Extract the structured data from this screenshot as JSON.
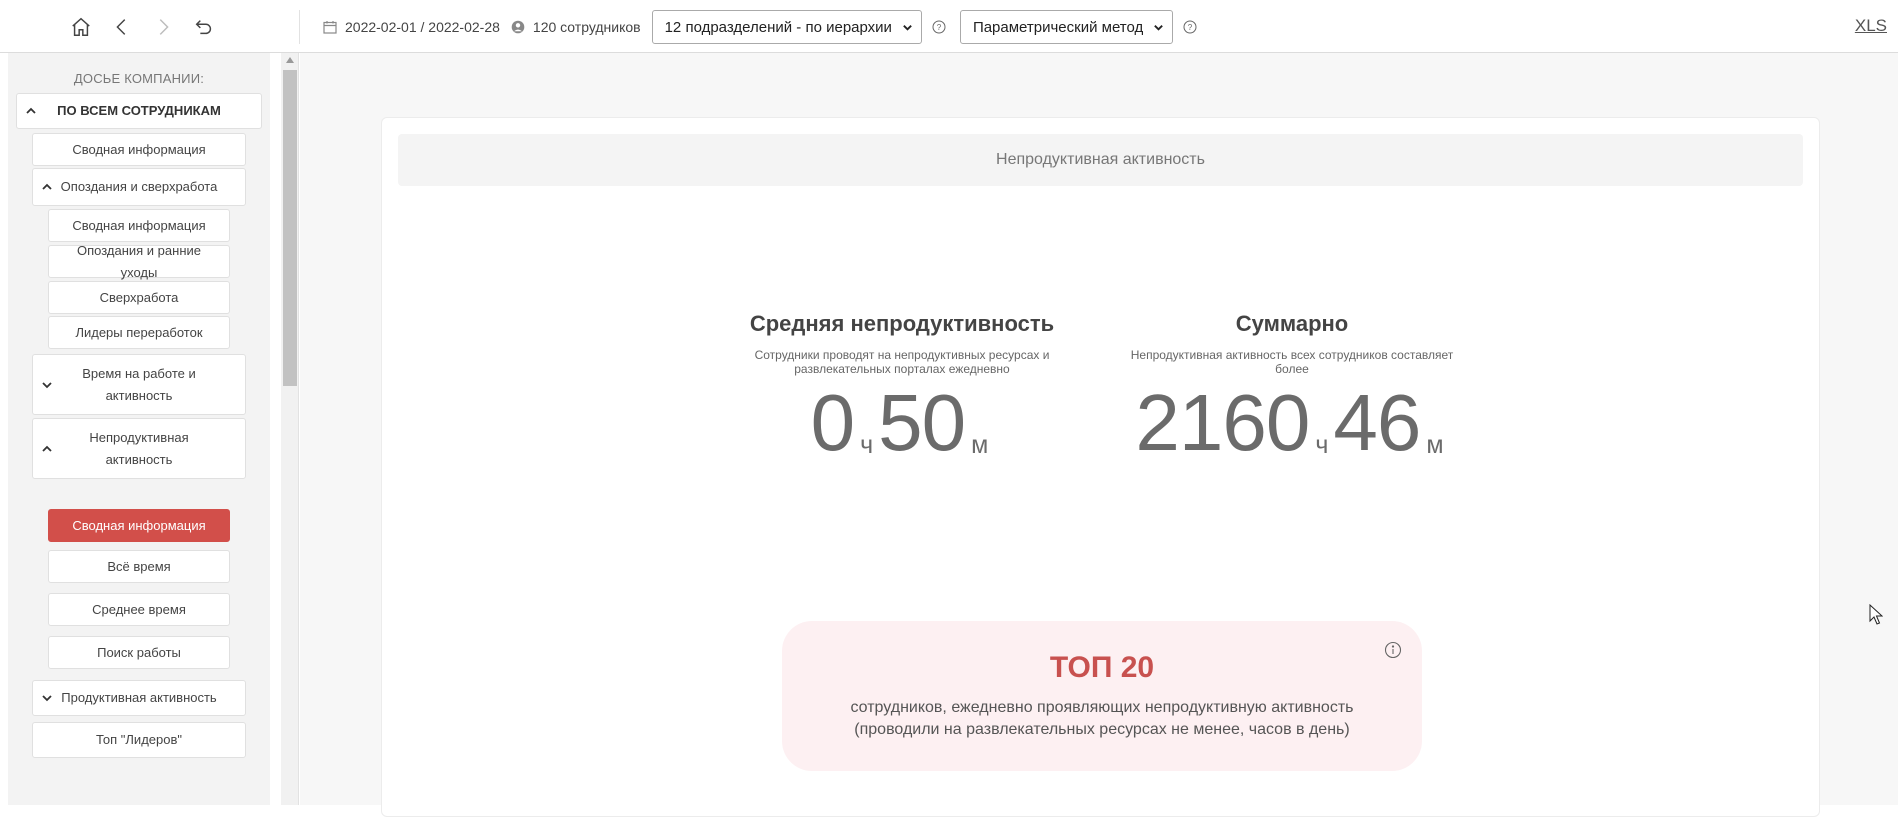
{
  "toolbar": {
    "date_range": "2022-02-01 / 2022-02-28",
    "employees": "120 сотрудников",
    "departments_select": "12 подразделений - по иерархии",
    "method_select": "Параметрический метод",
    "export_label": "XLS",
    "icons": [
      "home-icon",
      "back-icon",
      "forward-icon",
      "undo-icon",
      "calendar-icon",
      "user-icon",
      "help-icon"
    ]
  },
  "sidebar": {
    "title": "ДОСЬЕ КОМПАНИИ:",
    "items": [
      {
        "label": "ПО ВСЕМ СОТРУДНИКАМ",
        "level": 0,
        "expanded": true
      },
      {
        "label": "Сводная информация",
        "level": 1
      },
      {
        "label": "Опоздания и сверхработа",
        "level": 1,
        "expanded": true
      },
      {
        "label": "Сводная информация",
        "level": 2
      },
      {
        "label": "Опоздания и ранние уходы",
        "level": 2
      },
      {
        "label": "Сверхработа",
        "level": 2
      },
      {
        "label": "Лидеры переработок",
        "level": 2
      },
      {
        "label": "Время на работе и активность",
        "level": 1,
        "expanded": false
      },
      {
        "label": "Непродуктивная активность",
        "level": 1,
        "expanded": true
      },
      {
        "label": "Сводная информация",
        "level": 2,
        "active": true
      },
      {
        "label": "Всё время",
        "level": 2
      },
      {
        "label": "Среднее время",
        "level": 2
      },
      {
        "label": "Поиск работы",
        "level": 2
      },
      {
        "label": "Продуктивная активность",
        "level": 1,
        "expanded": false
      },
      {
        "label": "Топ \"Лидеров\"",
        "level": 1
      }
    ]
  },
  "main": {
    "section_title": "Непродуктивная активность",
    "avg": {
      "title": "Средняя непродуктивность",
      "desc": "Сотрудники проводят на непродуктивных ресурсах и развлекательных порталах ежедневно",
      "hours": "0",
      "hours_unit": "ч",
      "minutes": "50",
      "minutes_unit": "м"
    },
    "total": {
      "title": "Суммарно",
      "desc": "Непродуктивная активность всех сотрудников составляет более",
      "hours": "2160",
      "hours_unit": "ч",
      "minutes": "46",
      "minutes_unit": "м"
    },
    "top": {
      "title": "ТОП 20",
      "line1": "сотрудников, ежедневно проявляющих непродуктивную активность",
      "line2": "(проводили на развлекательных ресурсах не менее, часов в день)"
    }
  },
  "colors": {
    "accent": "#d24f4a",
    "top_title": "#c8514f",
    "top_bg": "#fdf0f2"
  }
}
